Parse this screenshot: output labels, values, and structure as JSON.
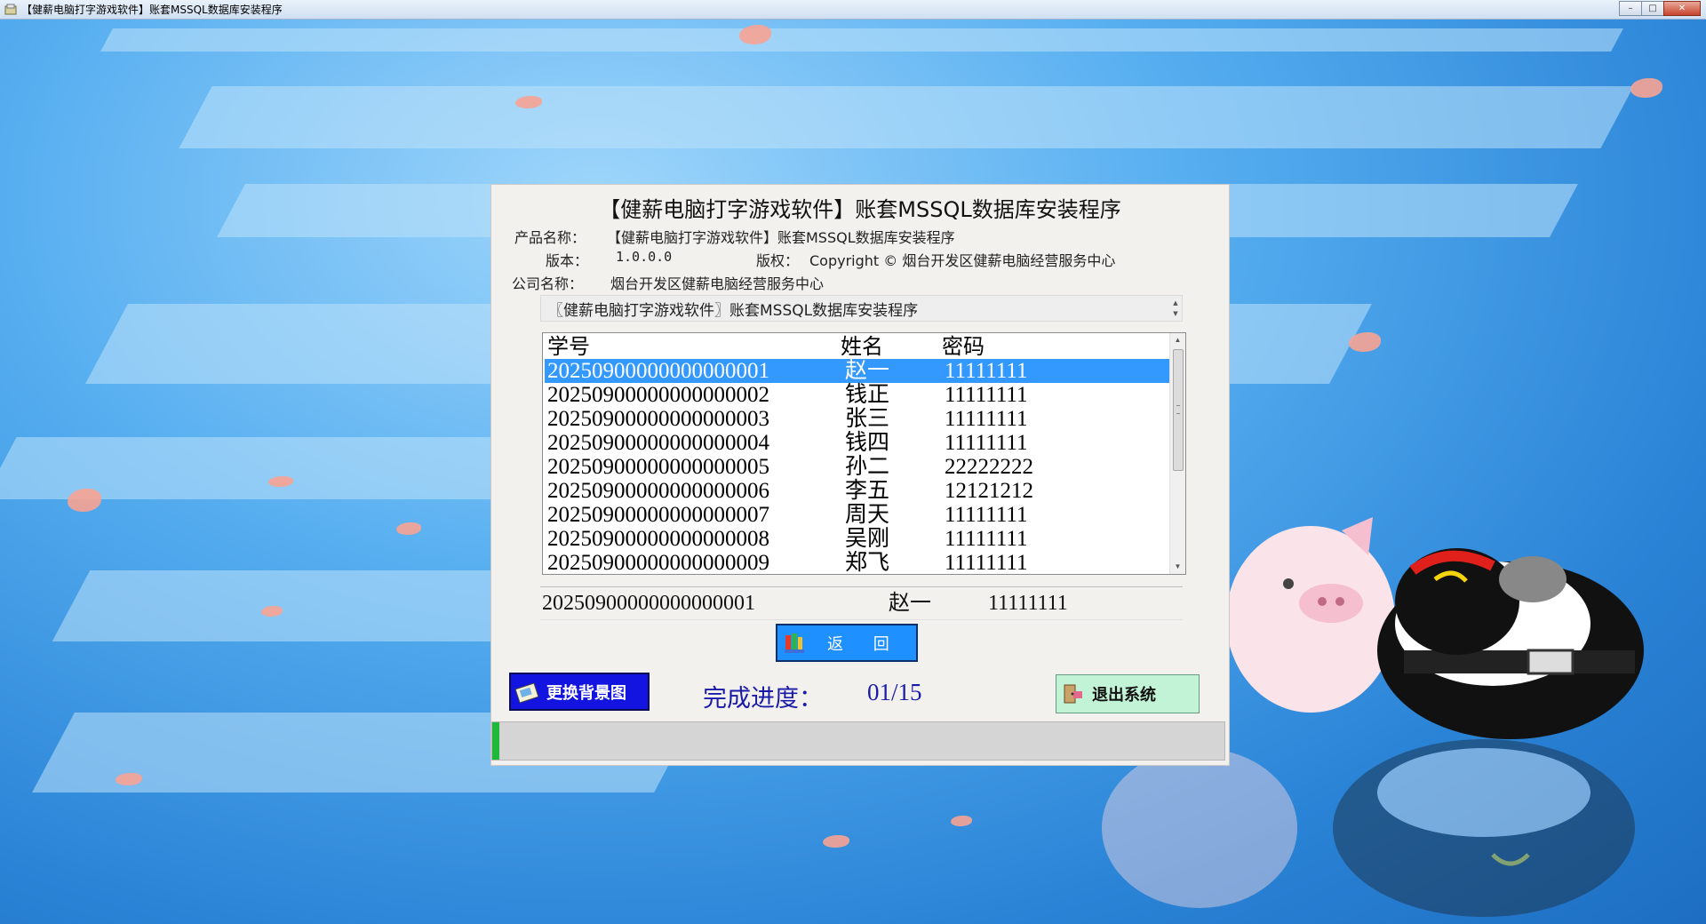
{
  "window": {
    "title": "【健薪电脑打字游戏软件】账套MSSQL数据库安装程序",
    "min_label": "–",
    "max_label": "□",
    "close_label": "✕"
  },
  "dialog": {
    "title": "【健薪电脑打字游戏软件】账套MSSQL数据库安装程序",
    "product_label": "产品名称：",
    "product_value": "【健薪电脑打字游戏软件】账套MSSQL数据库安装程序",
    "version_label": "版本：",
    "version_value": "1.0.0.0",
    "copyright_label": "版权：",
    "copyright_value": "Copyright © 烟台开发区健薪电脑经营服务中心",
    "company_label": "公司名称：",
    "company_value": "烟台开发区健薪电脑经营服务中心",
    "description": "〖健薪电脑打字游戏软件〗账套MSSQL数据库安装程序"
  },
  "list": {
    "columns": [
      "学号",
      "姓名",
      "密码"
    ],
    "rows": [
      [
        "20250900000000000001",
        "赵一",
        "11111111"
      ],
      [
        "20250900000000000002",
        "钱正",
        "11111111"
      ],
      [
        "20250900000000000003",
        "张三",
        "11111111"
      ],
      [
        "20250900000000000004",
        "钱四",
        "11111111"
      ],
      [
        "20250900000000000005",
        "孙二",
        "22222222"
      ],
      [
        "20250900000000000006",
        "李五",
        "12121212"
      ],
      [
        "20250900000000000007",
        "周天",
        "11111111"
      ],
      [
        "20250900000000000008",
        "吴刚",
        "11111111"
      ],
      [
        "20250900000000000009",
        "郑飞",
        "11111111"
      ]
    ],
    "selected_index": 0
  },
  "detail": {
    "id": "20250900000000000001",
    "name": "赵一",
    "password": "11111111"
  },
  "buttons": {
    "back": "返 回",
    "change_bg": "更换背景图",
    "exit": "退出系统"
  },
  "progress": {
    "label": "完成进度：",
    "value": "01/15",
    "fraction": 0.0667
  },
  "colors": {
    "accent": "#3399ff",
    "progress_fill": "#20b83a",
    "bg_button": "#1414e0",
    "exit_button": "#c2f3d6"
  }
}
